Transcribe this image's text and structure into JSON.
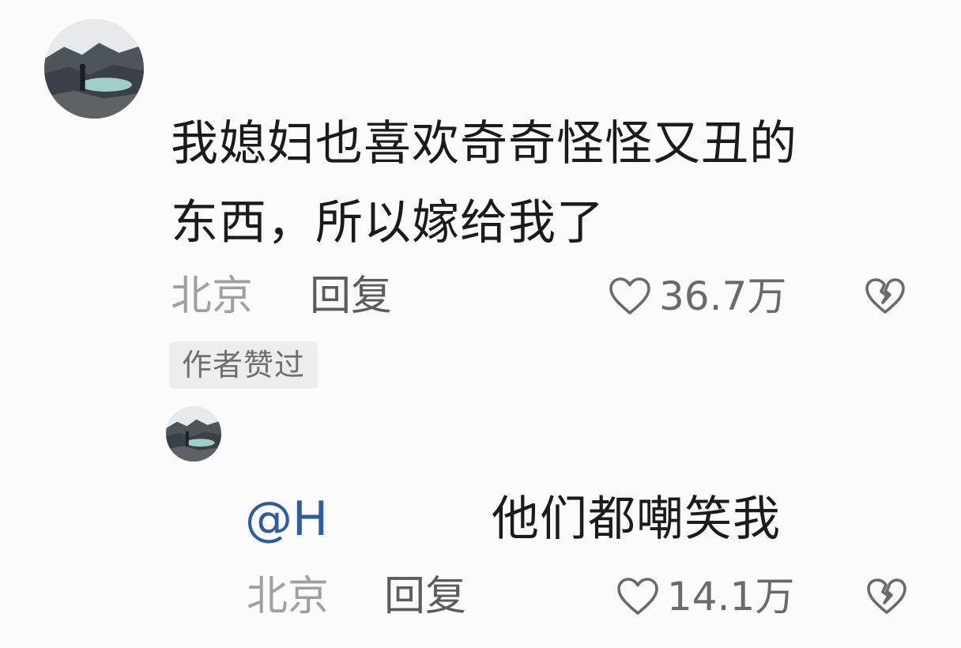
{
  "comment": {
    "text_line1": "我媳妇也喜欢奇奇怪怪又丑的",
    "text_line2": "东西，所以嫁给我了",
    "location": "北京",
    "reply_label": "回复",
    "likes": "36.7万",
    "badge": "作者赞过"
  },
  "reply": {
    "mention": "@H",
    "text": "他们都嘲笑我",
    "location": "北京",
    "reply_label": "回复",
    "likes": "14.1万"
  },
  "icons": {
    "like": "heart-outline-icon",
    "dislike": "broken-heart-icon",
    "avatar": "user-avatar-photo"
  },
  "colors": {
    "mention": "#2b5d9f",
    "text": "#1b1b1b",
    "meta": "#a0a0a0",
    "badge_bg": "#ededed"
  }
}
